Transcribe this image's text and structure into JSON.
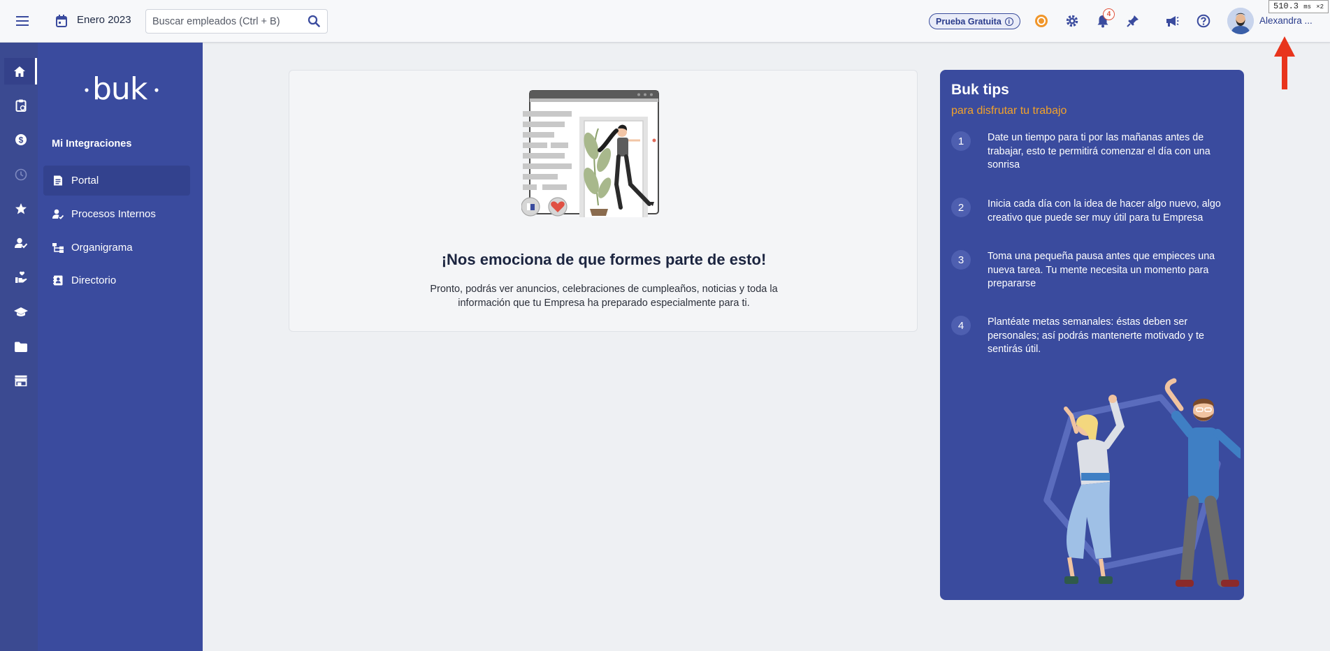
{
  "topbar": {
    "date_label": "Enero 2023",
    "search_placeholder": "Buscar empleados (Ctrl + B)",
    "trial_label": "Prueba Gratuita",
    "notification_count": "4",
    "user_name": "Alexandra ...",
    "perf_value": "510.3",
    "perf_unit": "ms",
    "perf_mult": "×2"
  },
  "rail": {
    "icons": [
      "home-icon",
      "clipboard-icon",
      "dollar-icon",
      "clock-icon",
      "star-icon",
      "user-check-icon",
      "hand-heart-icon",
      "graduation-cap-icon",
      "folder-icon",
      "store-icon"
    ],
    "active": "home-icon"
  },
  "sidebar": {
    "section_title": "Mi Integraciones",
    "items": [
      {
        "label": "Portal",
        "icon": "newspaper-icon",
        "active": true
      },
      {
        "label": "Procesos Internos",
        "icon": "user-process-icon",
        "active": false
      },
      {
        "label": "Organigrama",
        "icon": "org-chart-icon",
        "active": false
      },
      {
        "label": "Directorio",
        "icon": "contact-book-icon",
        "active": false
      }
    ]
  },
  "welcome": {
    "title": "¡Nos emociona de que formes parte de esto!",
    "body": "Pronto, podrás ver anuncios, celebraciones de cumpleaños, noticias y toda la información que tu Empresa ha preparado especialmente para ti."
  },
  "tips": {
    "title": "Buk tips",
    "subtitle": "para disfrutar tu trabajo",
    "items": [
      {
        "num": "1",
        "text": "Date un tiempo para ti por las mañanas antes de trabajar, esto te permitirá comenzar el día con una sonrisa"
      },
      {
        "num": "2",
        "text": "Inicia cada día con la idea de hacer algo nuevo, algo creativo que puede ser muy útil para tu Empresa"
      },
      {
        "num": "3",
        "text": "Toma una pequeña pausa antes que empieces una nueva tarea. Tu mente necesita un momento para prepararse"
      },
      {
        "num": "4",
        "text": "Plantéate metas semanales: éstas deben ser personales; así podrás mantenerte motivado y te sentirás útil."
      }
    ]
  },
  "colors": {
    "brand_blue": "#3a4b9e",
    "rail_blue": "#3b4a91",
    "accent_orange": "#f3a229",
    "notif_red": "#e0533c",
    "annotation_arrow": "#e8341c"
  }
}
